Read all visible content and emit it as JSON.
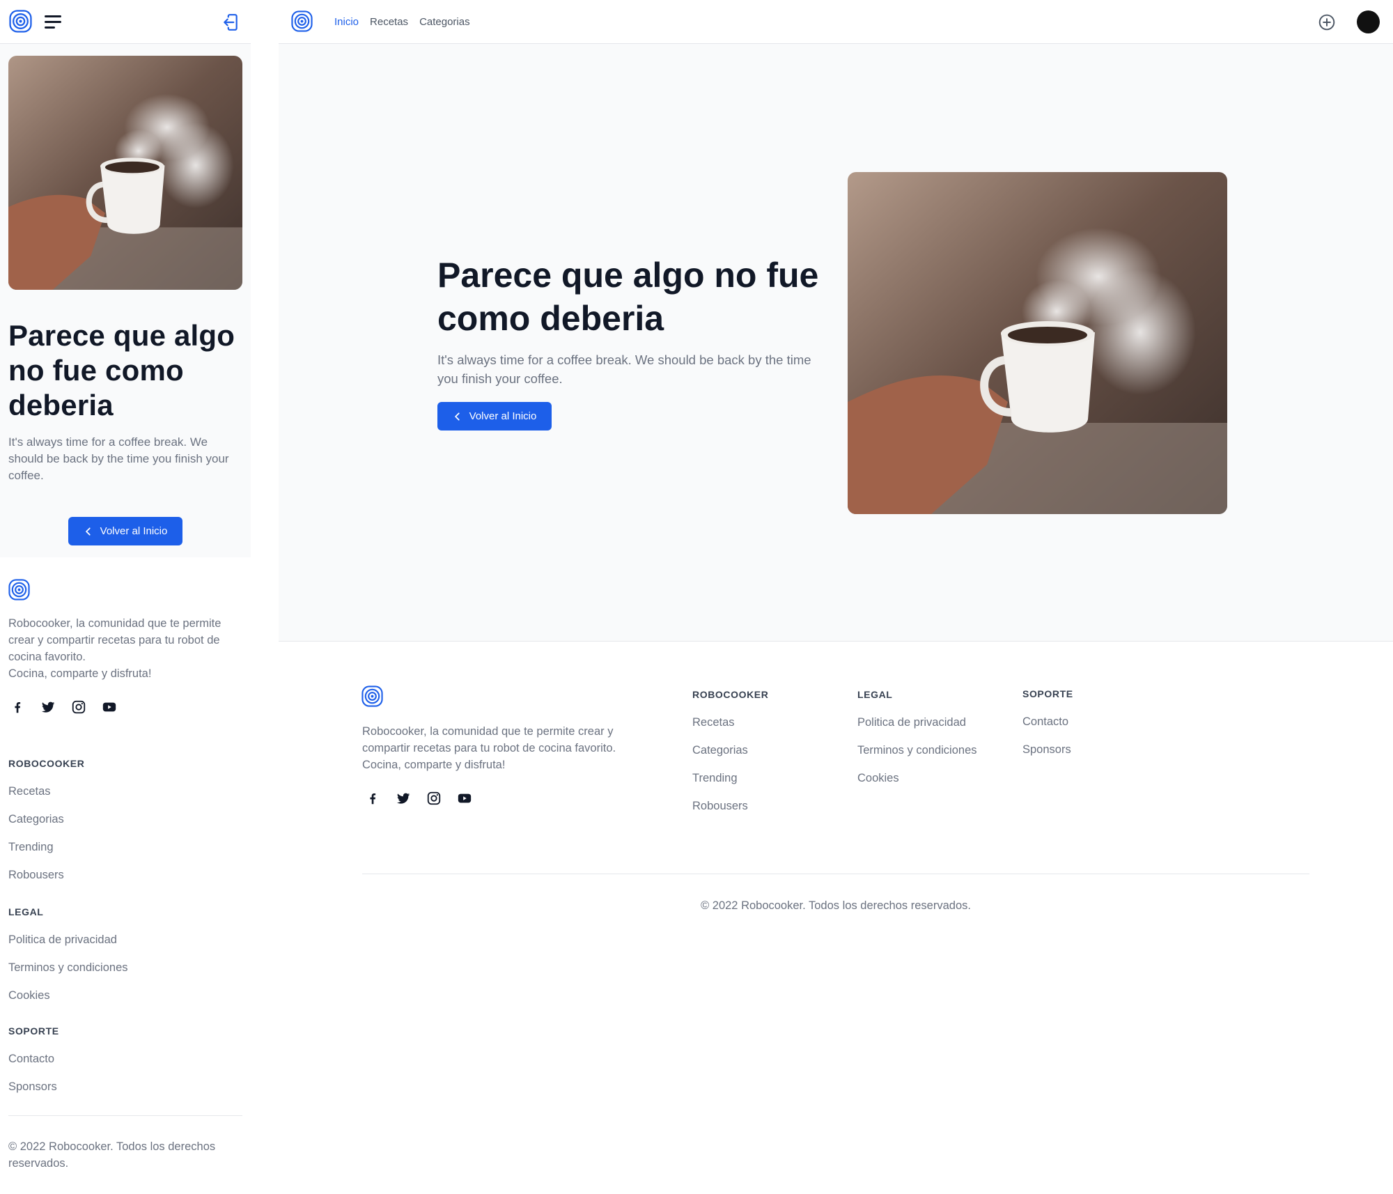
{
  "brand": {
    "name": "Robocooker",
    "accent": "#1d5fe9",
    "heading_color": "#111827",
    "text_muted": "#6b7280",
    "hero_bg": "#f9fafb"
  },
  "icons": {
    "logo": "spiral-logo-icon",
    "menu": "hamburger-menu-icon",
    "login": "login-arrow-icon",
    "add": "plus-circle-icon",
    "back": "chevron-left-icon",
    "facebook": "facebook-icon",
    "twitter": "twitter-icon",
    "instagram": "instagram-icon",
    "youtube": "youtube-icon"
  },
  "nav": {
    "items": [
      {
        "label": "Inicio",
        "active": true
      },
      {
        "label": "Recetas",
        "active": false
      },
      {
        "label": "Categorias",
        "active": false
      }
    ]
  },
  "hero": {
    "title": "Parece que algo no fue como deberia",
    "subtitle": "It's always time for a coffee break. We should be back by the time you finish your coffee.",
    "button_label": "Volver al Inicio",
    "image_alt": "Hand holding a steaming coffee cup"
  },
  "footer": {
    "description_line1": "Robocooker, la comunidad que te permite crear y compartir recetas para tu robot de cocina favorito.",
    "description_line2": "Cocina, comparte y disfruta!",
    "columns": [
      {
        "heading": "ROBOCOOKER",
        "links": [
          "Recetas",
          "Categorias",
          "Trending",
          "Robousers"
        ]
      },
      {
        "heading": "LEGAL",
        "links": [
          "Politica de privacidad",
          "Terminos y condiciones",
          "Cookies"
        ]
      },
      {
        "heading": "SOPORTE",
        "links": [
          "Contacto",
          "Sponsors"
        ]
      }
    ],
    "copyright": "© 2022 Robocooker. Todos los derechos reservados."
  }
}
